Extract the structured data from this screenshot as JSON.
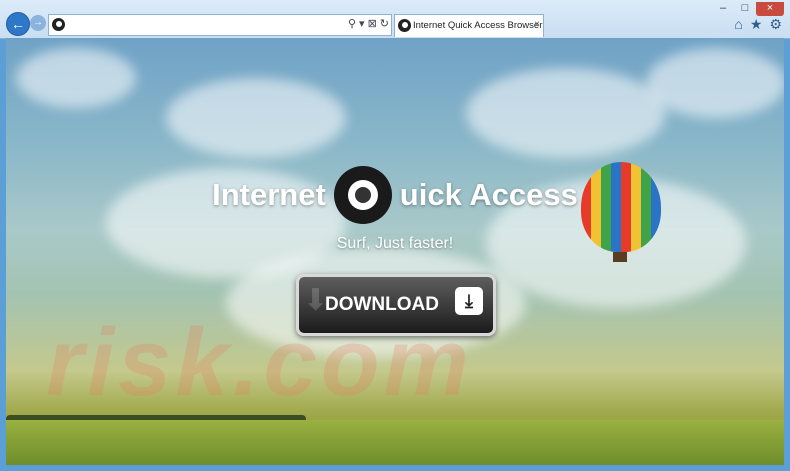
{
  "browser": {
    "tab_title": "Internet Quick Access Browser",
    "tab_close": "×",
    "back_icon": "←",
    "forward_icon": "→",
    "addr_tools": [
      "⚲",
      "▾",
      "⊠",
      "↻"
    ],
    "toolbar_icons": [
      "⌂",
      "★",
      "⚙"
    ],
    "window_controls": [
      "–",
      "□",
      "×"
    ]
  },
  "page": {
    "title_left": "Internet",
    "title_right": "uick Access",
    "tagline": "Surf, Just faster!",
    "download_label": "DOWNLOAD",
    "download_icon": "⤓",
    "watermark": "risk.com"
  }
}
